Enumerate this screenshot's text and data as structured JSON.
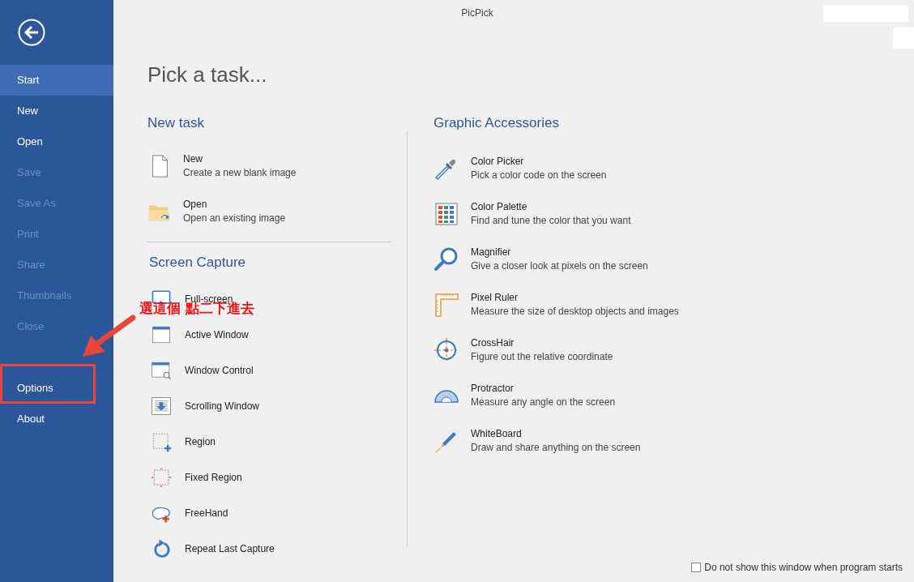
{
  "window": {
    "title": "PicPick"
  },
  "sidebar": {
    "items": [
      {
        "label": "Start",
        "selected": true,
        "disabled": false
      },
      {
        "label": "New",
        "selected": false,
        "disabled": false
      },
      {
        "label": "Open",
        "selected": false,
        "disabled": false
      },
      {
        "label": "Save",
        "selected": false,
        "disabled": true
      },
      {
        "label": "Save As",
        "selected": false,
        "disabled": true
      },
      {
        "label": "Print",
        "selected": false,
        "disabled": true
      },
      {
        "label": "Share",
        "selected": false,
        "disabled": true
      },
      {
        "label": "Thumbnails",
        "selected": false,
        "disabled": true
      },
      {
        "label": "Close",
        "selected": false,
        "disabled": true
      }
    ],
    "bottom_items": [
      {
        "label": "Options",
        "selected": false,
        "disabled": false
      },
      {
        "label": "About",
        "selected": false,
        "disabled": false
      }
    ]
  },
  "heading": "Pick a task...",
  "new_task": {
    "title": "New task",
    "items": [
      {
        "kind": "new",
        "name": "New",
        "description": "Create a new blank image"
      },
      {
        "kind": "open",
        "name": "Open",
        "description": "Open an existing image"
      }
    ]
  },
  "screen_capture": {
    "title": "Screen Capture",
    "items": [
      {
        "kind": "fullscreen",
        "name": "Full-screen"
      },
      {
        "kind": "active-window",
        "name": "Active Window"
      },
      {
        "kind": "window-control",
        "name": "Window Control"
      },
      {
        "kind": "scrolling",
        "name": "Scrolling Window"
      },
      {
        "kind": "region",
        "name": "Region"
      },
      {
        "kind": "fixed-region",
        "name": "Fixed Region"
      },
      {
        "kind": "freehand",
        "name": "FreeHand"
      },
      {
        "kind": "repeat",
        "name": "Repeat Last Capture"
      }
    ]
  },
  "graphic_accessories": {
    "title": "Graphic Accessories",
    "items": [
      {
        "kind": "picker",
        "name": "Color Picker",
        "description": "Pick a color code on the screen"
      },
      {
        "kind": "palette",
        "name": "Color Palette",
        "description": "Find and tune the color that you want"
      },
      {
        "kind": "magnifier",
        "name": "Magnifier",
        "description": "Give a closer look at pixels on the screen"
      },
      {
        "kind": "ruler",
        "name": "Pixel Ruler",
        "description": "Measure the size of desktop objects and images"
      },
      {
        "kind": "crosshair",
        "name": "CrossHair",
        "description": "Figure out the relative coordinate"
      },
      {
        "kind": "protractor",
        "name": "Protractor",
        "description": "Measure any angle on the screen"
      },
      {
        "kind": "whiteboard",
        "name": "WhiteBoard",
        "description": "Draw and share anything on the screen"
      }
    ]
  },
  "startup_checkbox": {
    "label": "Do not show this window when program starts",
    "checked": false
  },
  "annotation": {
    "text": "選這個 點二下進去"
  }
}
